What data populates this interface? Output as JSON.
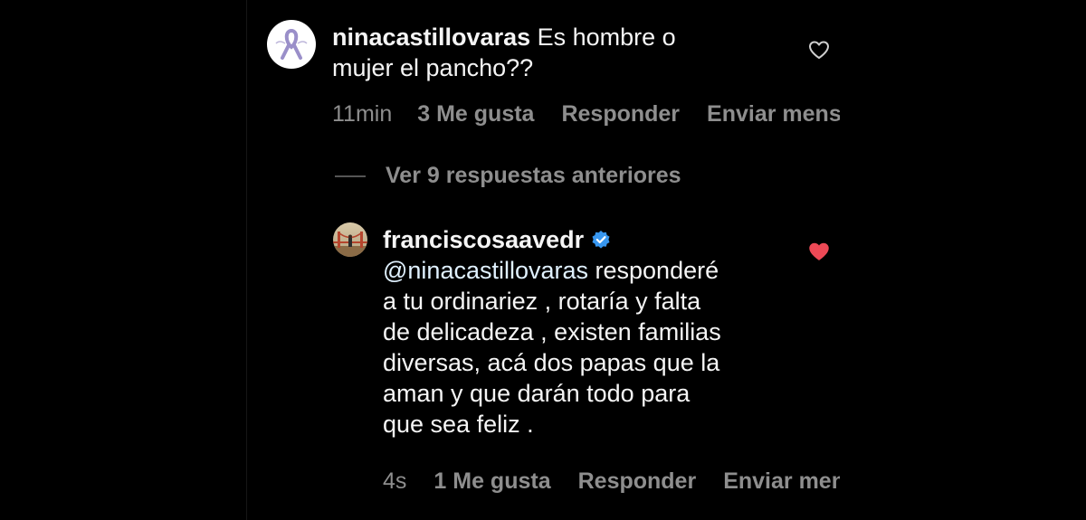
{
  "comment": {
    "username": "ninacastillovaras",
    "text_line1": " Es hombre o",
    "text_line2": "mujer el pancho??",
    "time": "11min",
    "likes": "3 Me gusta",
    "reply_label": "Responder",
    "send_label": "Enviar mensaje",
    "liked": false
  },
  "replies_toggle": {
    "label": "Ver 9 respuestas anteriores"
  },
  "reply": {
    "username": "franciscosaavedr",
    "verified": true,
    "mention": "@ninacastillovaras",
    "text_line1_rest": " responderé",
    "text_line2": "a tu ordinariez , rotaría y falta",
    "text_line3": "de delicadeza , existen familias",
    "text_line4": "diversas, acá dos papas que la",
    "text_line5": "aman y que darán todo para",
    "text_line6": "que sea feliz .",
    "time": "4s",
    "likes": "1 Me gusta",
    "reply_label": "Responder",
    "send_label": "Enviar mensaje",
    "liked": true
  },
  "colors": {
    "background": "#000000",
    "text": "#f5f5f5",
    "secondary_text": "#8e8e8e",
    "heart_liked": "#ed4956",
    "verified_badge": "#3897f0"
  },
  "icons": {
    "comment_avatar": "ribbon-logo-avatar",
    "reply_avatar": "bridge-photo-avatar",
    "like_outline": "heart-outline-icon",
    "like_filled": "heart-filled-icon",
    "verified": "verified-badge-icon"
  }
}
